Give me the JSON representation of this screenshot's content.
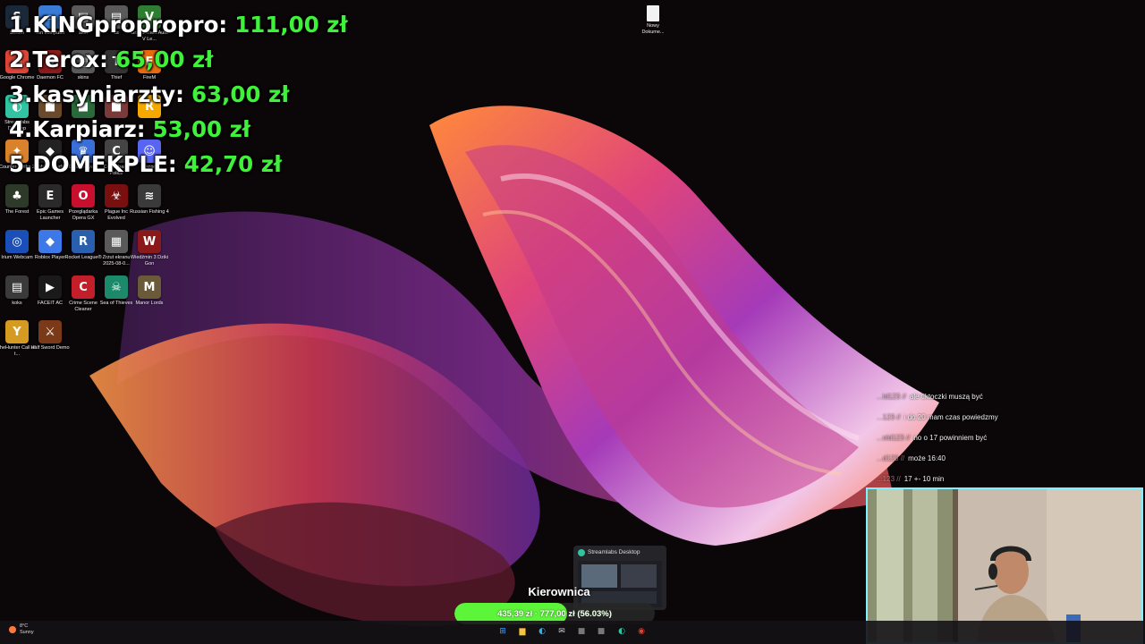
{
  "leaderboard": [
    {
      "rank": "1.",
      "name": "KINGpropropro:",
      "amount": "111,00 zł"
    },
    {
      "rank": "2.",
      "name": "Terox:",
      "amount": "65,00 zł"
    },
    {
      "rank": "3.",
      "name": "kasyniarzty:",
      "amount": "63,00 zł"
    },
    {
      "rank": "4.",
      "name": "Karpiarz:",
      "amount": "53,00 zł"
    },
    {
      "rank": "5.",
      "name": "DOMEKPLE:",
      "amount": "42,70 zł"
    }
  ],
  "desktop_icons": [
    {
      "label": "Steam",
      "icon": "steam-icon",
      "color": "#1b2838",
      "glyph": "S"
    },
    {
      "label": "Ten komputer",
      "icon": "computer-icon",
      "color": "#3a7bd5",
      "glyph": "▭"
    },
    {
      "label": "skin",
      "icon": "folder-icon",
      "color": "#5a5a5a",
      "glyph": "▤"
    },
    {
      "label": "cs",
      "icon": "folder-icon",
      "color": "#5a5a5a",
      "glyph": "▤"
    },
    {
      "label": "Grand Theft Auto V Le...",
      "icon": "gta-icon",
      "color": "#2e7d32",
      "glyph": "V"
    },
    {
      "label": "Google Chrome",
      "icon": "chrome-icon",
      "color": "#db4437",
      "glyph": "◉"
    },
    {
      "label": "Daemon FC",
      "icon": "game-icon",
      "color": "#8b1a1a",
      "glyph": "D"
    },
    {
      "label": "skins",
      "icon": "folder-icon",
      "color": "#5a5a5a",
      "glyph": "▤"
    },
    {
      "label": "Thief",
      "icon": "thief-icon",
      "color": "#333333",
      "glyph": "T"
    },
    {
      "label": "FireM",
      "icon": "game-icon",
      "color": "#e86a10",
      "glyph": "F"
    },
    {
      "label": "Streamlabs Desktop",
      "icon": "streamlabs-icon",
      "color": "#31c3a2",
      "glyph": "◐"
    },
    {
      "label": "",
      "icon": "game-icon",
      "color": "#6a4a2a",
      "glyph": "■"
    },
    {
      "label": "",
      "icon": "game-icon",
      "color": "#2a6a3a",
      "glyph": "■"
    },
    {
      "label": "",
      "icon": "game-icon",
      "color": "#7a3a3a",
      "glyph": "■"
    },
    {
      "label": "",
      "icon": "rockstar-icon",
      "color": "#f5a800",
      "glyph": "R"
    },
    {
      "label": "Counter-Strike 2",
      "icon": "cs2-icon",
      "color": "#d9822b",
      "glyph": "✦"
    },
    {
      "label": "Roblox Studio",
      "icon": "roblox-studio-icon",
      "color": "#222222",
      "glyph": "◆"
    },
    {
      "label": "Clash Royale",
      "icon": "clash-royale-icon",
      "color": "#3b6fd8",
      "glyph": "♛"
    },
    {
      "label": "Contraband Police",
      "icon": "game-icon",
      "color": "#444444",
      "glyph": "C"
    },
    {
      "label": "Discord",
      "icon": "discord-icon",
      "color": "#5865f2",
      "glyph": "☺"
    },
    {
      "label": "The Forest",
      "icon": "game-icon",
      "color": "#2d3a2a",
      "glyph": "♣"
    },
    {
      "label": "Epic Games Launcher",
      "icon": "epic-icon",
      "color": "#2a2a2a",
      "glyph": "E"
    },
    {
      "label": "Przeglądarka Opera GX",
      "icon": "opera-gx-icon",
      "color": "#c8102e",
      "glyph": "O"
    },
    {
      "label": "Plague Inc Evolved",
      "icon": "plague-icon",
      "color": "#7a0f0f",
      "glyph": "☣"
    },
    {
      "label": "Russian Fishing 4",
      "icon": "game-icon",
      "color": "#3a3a3a",
      "glyph": "≋"
    },
    {
      "label": "Irium Webcam",
      "icon": "webcam-icon",
      "color": "#1a4fb8",
      "glyph": "◎"
    },
    {
      "label": "Roblox Player",
      "icon": "roblox-icon",
      "color": "#3c78e8",
      "glyph": "◆"
    },
    {
      "label": "Rocket League®",
      "icon": "rocket-league-icon",
      "color": "#2a5fae",
      "glyph": "R"
    },
    {
      "label": "Zrzut ekranu 2025-08-0...",
      "icon": "image-file-icon",
      "color": "#5a5a5a",
      "glyph": "▦"
    },
    {
      "label": "Wiedźmin 3 Dziki Gon",
      "icon": "witcher-icon",
      "color": "#8a1a1a",
      "glyph": "W"
    },
    {
      "label": "koks",
      "icon": "folder-icon",
      "color": "#3a3a3a",
      "glyph": "▤"
    },
    {
      "label": "FACEIT AC",
      "icon": "faceit-icon",
      "color": "#1a1a1a",
      "glyph": "▶"
    },
    {
      "label": "Crime Scene Cleaner",
      "icon": "game-icon",
      "color": "#c21f2a",
      "glyph": "C"
    },
    {
      "label": "Sea of Thieves",
      "icon": "sea-of-thieves-icon",
      "color": "#1c8a6a",
      "glyph": "☠"
    },
    {
      "label": "Manor Lords",
      "icon": "game-icon",
      "color": "#6a5a3a",
      "glyph": "M"
    },
    {
      "label": "theHunter Call of t...",
      "icon": "game-icon",
      "color": "#d49a22",
      "glyph": "Y"
    },
    {
      "label": "Half Sword Demo",
      "icon": "game-icon",
      "color": "#7a3a1a",
      "glyph": "⚔"
    }
  ],
  "desktop_file": {
    "label": "Nowy Dokume...",
    "icon": "document-icon"
  },
  "chat": [
    {
      "user": "...ld123 //",
      "message": "ale tiktoczki muszą być"
    },
    {
      "user": "...123 //",
      "message": "i do 20 mam czas powiedzmy"
    },
    {
      "user": "...old123 //",
      "message": "no o 17 powinniem być"
    },
    {
      "user": "...d123 //",
      "message": "może 16:40"
    },
    {
      "user": "...123 //",
      "message": "17 +- 10 min"
    }
  ],
  "streamlabs_preview": {
    "title": "Streamlabs Desktop",
    "icon": "streamlabs-icon"
  },
  "goal": {
    "title": "Kierownica",
    "text": "435,39 zł  ·  777,00 zł  (56.03%)",
    "progress_percent": 56.03,
    "color": "#5df53a"
  },
  "weather": {
    "temp": "8°C",
    "condition": "Sunny",
    "icon": "weather-icon"
  },
  "taskbar_icons": [
    {
      "name": "windows-start-icon",
      "glyph": "⊞",
      "color": "#3aa0ff"
    },
    {
      "name": "file-explorer-icon",
      "glyph": "▆",
      "color": "#f5c542"
    },
    {
      "name": "edge-icon",
      "glyph": "◐",
      "color": "#2fb0e8"
    },
    {
      "name": "mail-icon",
      "glyph": "✉",
      "color": "#cccccc"
    },
    {
      "name": "app-icon",
      "glyph": "■",
      "color": "#777777"
    },
    {
      "name": "app-icon",
      "glyph": "■",
      "color": "#777777"
    },
    {
      "name": "streamlabs-taskbar-icon",
      "glyph": "◐",
      "color": "#31c3a2"
    },
    {
      "name": "chrome-taskbar-icon",
      "glyph": "◉",
      "color": "#db4437"
    }
  ]
}
